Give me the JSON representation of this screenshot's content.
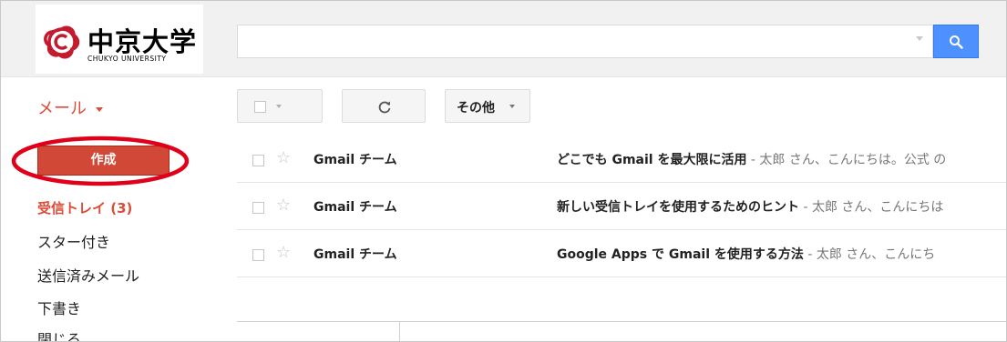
{
  "logo": {
    "name": "中京大学",
    "sub": "CHUKYO UNIVERSITY"
  },
  "search": {
    "value": "",
    "placeholder": ""
  },
  "mail_menu": {
    "label": "メール"
  },
  "toolbar": {
    "more_label": "その他"
  },
  "compose_label": "作成",
  "nav": {
    "inbox": "受信トレイ (3)",
    "starred": "スター付き",
    "sent": "送信済みメール",
    "drafts": "下書き",
    "cut": "閉じる"
  },
  "emails": [
    {
      "sender": "Gmail チーム",
      "subject": "どこでも Gmail を最大限に活用",
      "snippet": " - 太郎 さん、こんにちは。公式 の"
    },
    {
      "sender": "Gmail チーム",
      "subject": "新しい受信トレイを使用するためのヒント",
      "snippet": " - 太郎 さん、こんにちは"
    },
    {
      "sender": "Gmail チーム",
      "subject": "Google Apps で Gmail を使用する方法",
      "snippet": " - 太郎 さん、こんにち"
    }
  ],
  "colors": {
    "accent_red": "#dd4b39",
    "compose_red": "#d14836",
    "search_blue": "#4d90fe",
    "annotation_red": "#e0001a"
  }
}
